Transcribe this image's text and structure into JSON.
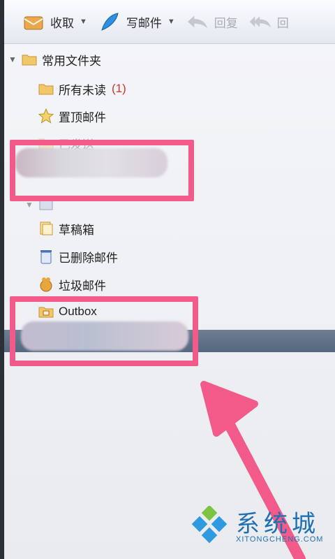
{
  "toolbar": {
    "receive": "收取",
    "compose": "写邮件",
    "reply": "回复",
    "reply_all": "回"
  },
  "tree": {
    "root": "常用文件夹",
    "unread": "所有未读",
    "unread_count": "(1)",
    "starred": "置顶邮件",
    "sent": "已发送",
    "drafts": "草稿箱",
    "deleted": "已删除邮件",
    "junk": "垃圾邮件",
    "outbox": "Outbox"
  },
  "watermark": {
    "text": "系统城",
    "sub": "XITONGCHENG.COM"
  },
  "colors": {
    "highlight": "#f25a8a",
    "selection": "#5f7088",
    "accent": "#1f6fb3"
  }
}
